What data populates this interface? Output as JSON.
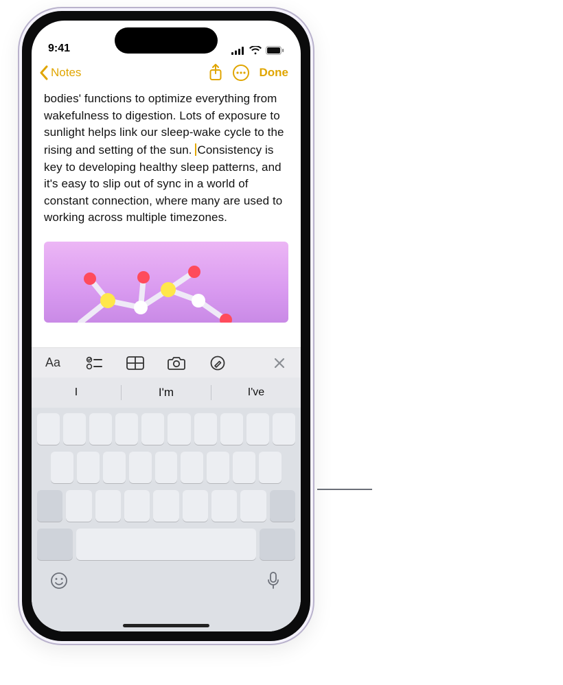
{
  "status": {
    "time": "9:41"
  },
  "nav": {
    "back_label": "Notes",
    "done_label": "Done"
  },
  "note": {
    "body_before_caret": "bodies' functions to optimize everything from wakefulness to digestion. Lots of exposure to sunlight helps link our sleep-wake cycle to the rising and setting of the sun. ",
    "body_after_caret": "Consistency is key to developing healthy sleep patterns, and it's easy to slip out of sync in a world of constant connection, where many are used to working across multiple timezones."
  },
  "suggestions": [
    "I",
    "I'm",
    "I've"
  ],
  "icons": {
    "back": "chevron-left-icon",
    "share": "share-icon",
    "more": "ellipsis-circle-icon",
    "format_text": "text-format-icon",
    "format_checklist": "checklist-icon",
    "format_table": "table-icon",
    "format_camera": "camera-icon",
    "format_markup": "markup-icon",
    "format_close": "close-icon",
    "kb_emoji": "emoji-icon",
    "kb_mic": "mic-icon"
  },
  "colors": {
    "accent": "#e0a500"
  }
}
